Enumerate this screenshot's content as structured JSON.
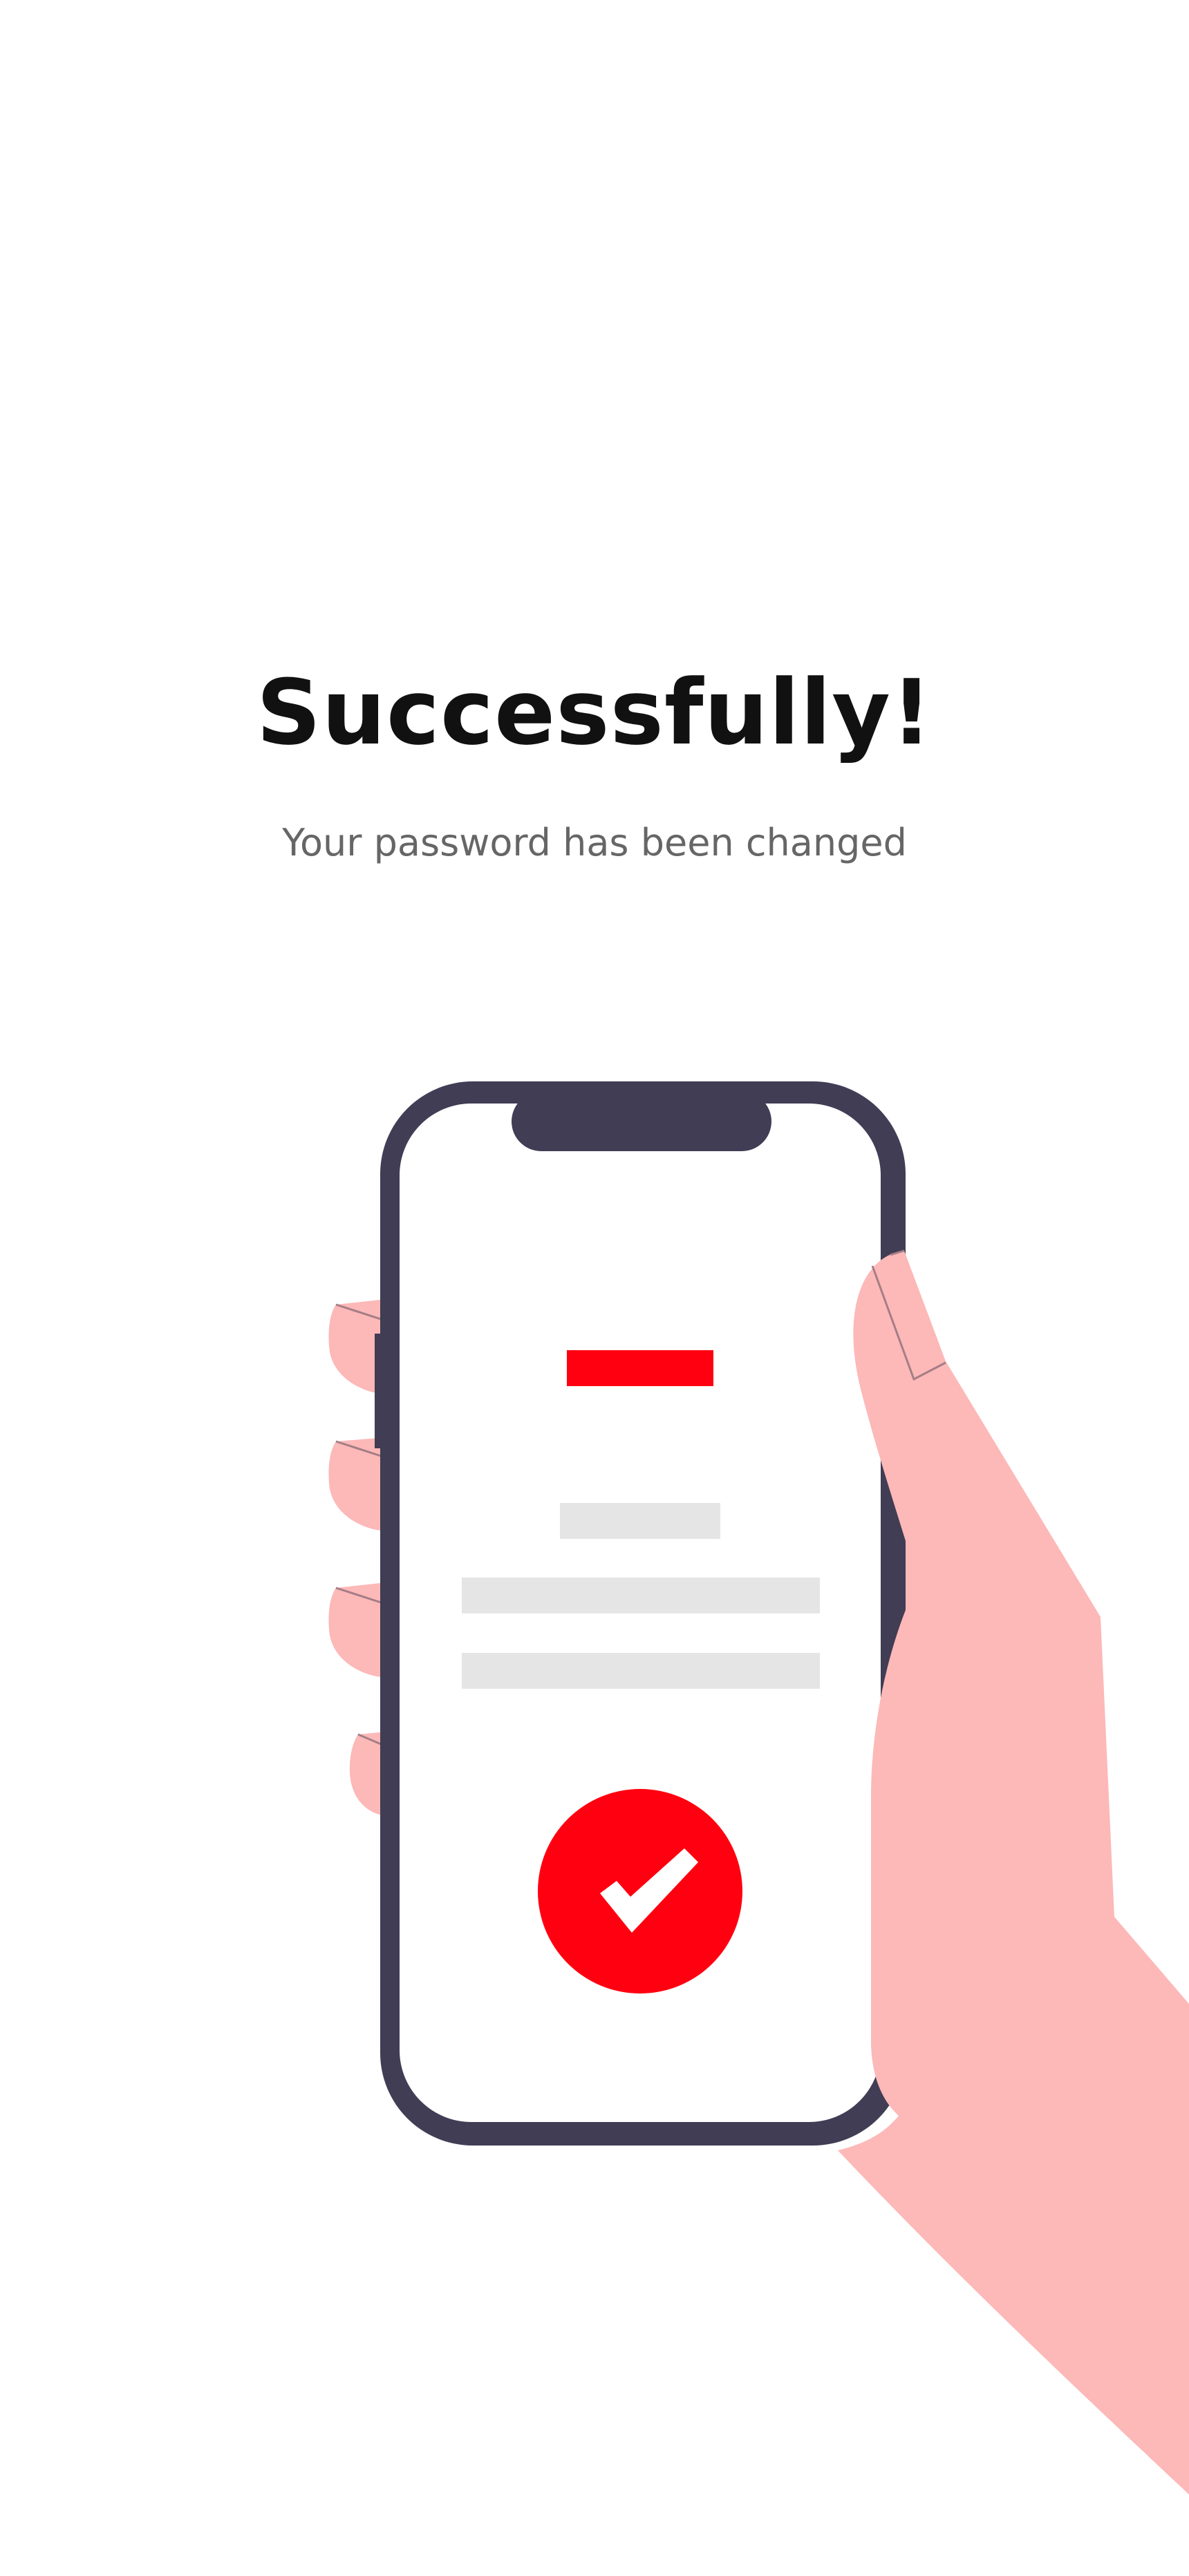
{
  "header": {
    "title": "Successfully!",
    "subtitle": "Your password has been changed"
  },
  "illustration": {
    "phone_frame_color": "#403D55",
    "hand_color": "#FDB8B8",
    "accent_color": "#FF0010",
    "placeholder_color": "#E5E5E5",
    "icons": [
      "phone-illustration",
      "hand-illustration",
      "checkmark-icon"
    ]
  }
}
